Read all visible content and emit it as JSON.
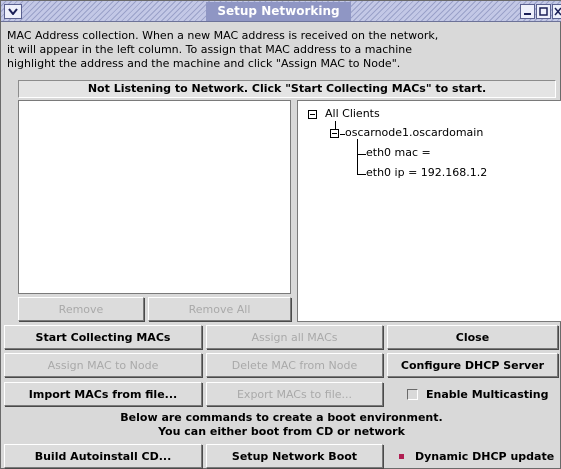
{
  "window": {
    "title": "Setup Networking"
  },
  "intro": {
    "lines": [
      "MAC Address collection.  When a new MAC address is received on the network,",
      "it will appear in the left column.  To assign that MAC address to a machine",
      "highlight the address and the machine and click \"Assign MAC to Node\"."
    ]
  },
  "status": "Not Listening to Network. Click \"Start Collecting MACs\" to start.",
  "tree": {
    "root": "All Clients",
    "node": "oscarnode1.oscardomain",
    "children": [
      "eth0 mac =",
      "eth0 ip = 192.168.1.2"
    ]
  },
  "list_buttons": {
    "remove": "Remove",
    "remove_all": "Remove All"
  },
  "buttons": {
    "start_collecting": "Start Collecting MACs",
    "assign_all": "Assign all MACs",
    "close": "Close",
    "assign_mac": "Assign MAC to Node",
    "delete_mac": "Delete MAC from Node",
    "configure_dhcp": "Configure DHCP Server",
    "import_macs": "Import MACs from file...",
    "export_macs": "Export MACs to file...",
    "build_autoinstall": "Build Autoinstall CD...",
    "setup_boot": "Setup Network Boot"
  },
  "checkboxes": {
    "multicasting": {
      "label": "Enable Multicasting",
      "checked": false
    },
    "dynamic_dhcp": {
      "label": "Dynamic DHCP update",
      "checked": true
    }
  },
  "boot_caption": [
    "Below are commands to create a boot environment.",
    "You can either boot from CD or network"
  ],
  "colors": {
    "titlebar": "#9aa1c9",
    "checked_box": "#b01e52",
    "disabled_text": "#a9a9a9"
  }
}
